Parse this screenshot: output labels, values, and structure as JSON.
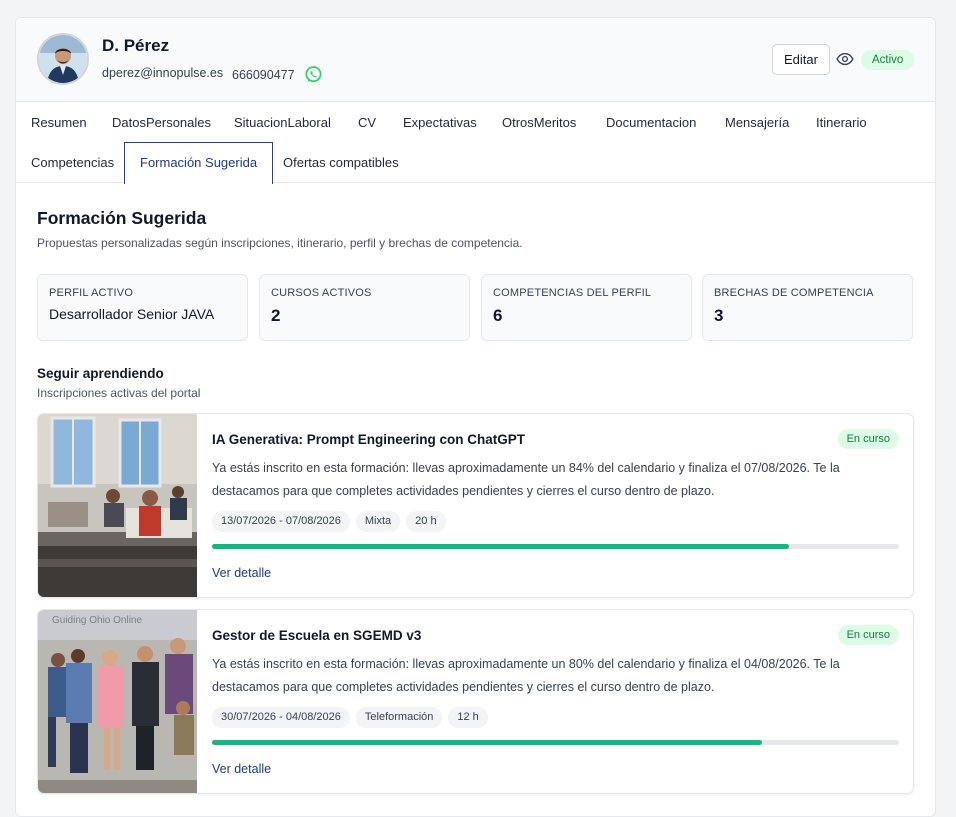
{
  "profile": {
    "name": "D. Pérez",
    "email": "dperez@innopulse.es",
    "phone": "666090477",
    "edit_label": "Editar",
    "status": "Activo"
  },
  "tabs": [
    {
      "label": "Resumen"
    },
    {
      "label": "DatosPersonales"
    },
    {
      "label": "SituacionLaboral"
    },
    {
      "label": "CV"
    },
    {
      "label": "Expectativas"
    },
    {
      "label": "OtrosMeritos"
    },
    {
      "label": "Documentacion"
    },
    {
      "label": "Mensajería"
    },
    {
      "label": "Itinerario"
    },
    {
      "label": "Competencias"
    },
    {
      "label": "Formación Sugerida",
      "active": true
    },
    {
      "label": "Ofertas compatibles"
    }
  ],
  "section": {
    "title": "Formación Sugerida",
    "subtitle": "Propuestas personalizadas según inscripciones, itinerario, perfil y brechas de competencia."
  },
  "stats": [
    {
      "label": "PERFIL ACTIVO",
      "value": "Desarrollador Senior JAVA"
    },
    {
      "label": "CURSOS ACTIVOS",
      "value": "2"
    },
    {
      "label": "COMPETENCIAS DEL PERFIL",
      "value": "6"
    },
    {
      "label": "BRECHAS DE COMPETENCIA",
      "value": "3"
    }
  ],
  "learning": {
    "title": "Seguir aprendiendo",
    "subtitle": "Inscripciones activas del portal",
    "courses": [
      {
        "title": "IA Generativa: Prompt Engineering con ChatGPT",
        "badge": "En curso",
        "description": "Ya estás inscrito en esta formación: llevas aproximadamente un 84% del calendario y finaliza el 07/08/2026. Te la destacamos para que completes actividades pendientes y cierres el curso dentro de plazo.",
        "dates": "13/07/2026 - 07/08/2026",
        "modality": "Mixta",
        "hours": "20 h",
        "progress": 84,
        "link": "Ver detalle"
      },
      {
        "title": "Gestor de Escuela en SGEMD v3",
        "badge": "En curso",
        "description": "Ya estás inscrito en esta formación: llevas aproximadamente un 80% del calendario y finaliza el 04/08/2026. Te la destacamos para que completes actividades pendientes y cierres el curso dentro de plazo.",
        "dates": "30/07/2026 - 04/08/2026",
        "modality": "Teleformación",
        "hours": "12 h",
        "progress": 80,
        "link": "Ver detalle",
        "image_text": "Guiding Ohio Online"
      }
    ]
  },
  "colors": {
    "accent": "#1e3a8a",
    "success": "#10b981",
    "badge_bg": "#dcfce7",
    "whatsapp": "#25d366"
  }
}
